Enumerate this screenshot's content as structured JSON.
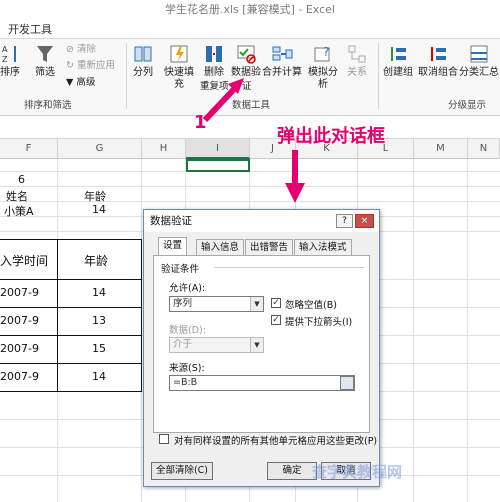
{
  "window": {
    "title": "学生花名册.xls  [兼容模式] - Excel"
  },
  "ribbon": {
    "tab": "开发工具",
    "sort_label": "排序",
    "filter_label": "筛选",
    "clear_label": "清除",
    "reapply_label": "重新应用",
    "advanced_label": "高级",
    "group_sortfilter": "排序和筛选",
    "split_label": "分列",
    "flashfill_label": "快速填充",
    "remove_dup_label": "删除",
    "remove_dup_label2": "重复项",
    "validation_label": "数据验",
    "validation_label2": "证",
    "consolidate_label": "合并计算",
    "whatif_label": "模拟分析",
    "relations_label": "关系",
    "group_datatools": "数据工具",
    "group_label": "创建组",
    "ungroup_label": "取消组合",
    "subtotal_label": "分类汇总",
    "group_outline": "分级显示"
  },
  "columns": [
    "F",
    "G",
    "H",
    "I",
    "J",
    "K",
    "L",
    "M",
    "N"
  ],
  "sheet": {
    "f_num": "6",
    "name_header": "姓名",
    "age_header": "年龄",
    "name_value": "小策A",
    "age_value": "14",
    "tbl_col1": "入学时间",
    "tbl_col2": "年龄",
    "rows": [
      {
        "date": "2007-9",
        "age": "14"
      },
      {
        "date": "2007-9",
        "age": "13"
      },
      {
        "date": "2007-9",
        "age": "15"
      },
      {
        "date": "2007-9",
        "age": "14"
      }
    ]
  },
  "annotation": {
    "callout_text": "弹出此对话框",
    "step_number": "1"
  },
  "dialog": {
    "title": "数据验证",
    "help": "?",
    "close": "×",
    "tabs": [
      "设置",
      "输入信息",
      "出错警告",
      "输入法模式"
    ],
    "criteria_label": "验证条件",
    "allow_label": "允许(A):",
    "allow_value": "序列",
    "data_label": "数据(D):",
    "data_value": "介于",
    "ignore_blank": "忽略空值(B)",
    "dropdown": "提供下拉箭头(I)",
    "source_label": "来源(S):",
    "source_value": "=B:B",
    "apply_all": "对有同样设置的所有其他单元格应用这些更改(P)",
    "clear_all": "全部清除(C)",
    "ok": "确定",
    "cancel": "取消"
  },
  "watermark": "查字典教程网"
}
